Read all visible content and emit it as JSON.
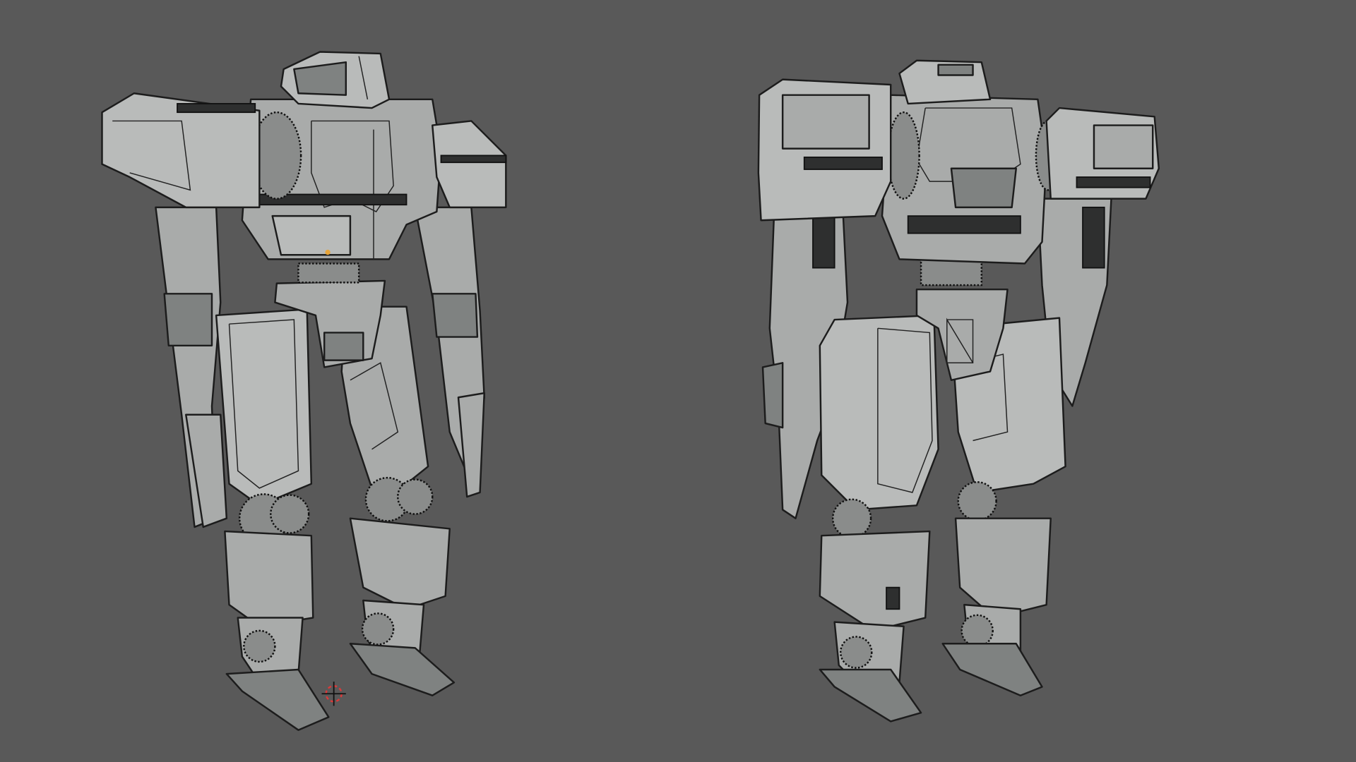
{
  "viewport": {
    "background_color": "#595959",
    "model_color": "#a9abaa",
    "edge_color": "#1c1c1c",
    "objects": [
      {
        "view": "front-three-quarter"
      },
      {
        "view": "back-three-quarter"
      }
    ],
    "icons": [
      "3d-cursor-icon",
      "origin-point-icon"
    ]
  }
}
